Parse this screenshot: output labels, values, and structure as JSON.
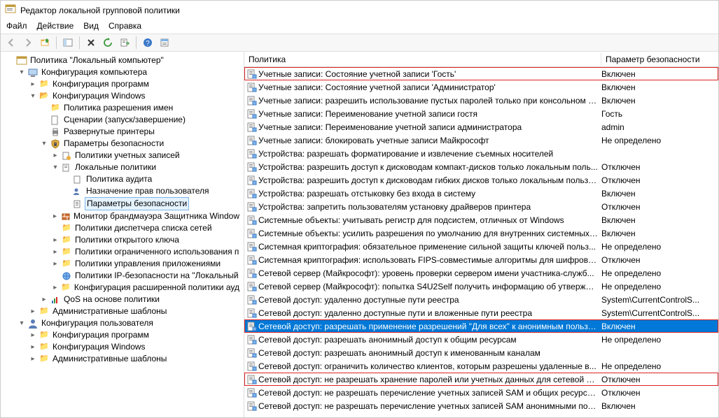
{
  "window": {
    "title": "Редактор локальной групповой политики"
  },
  "menu": {
    "file": "Файл",
    "action": "Действие",
    "view": "Вид",
    "help": "Справка"
  },
  "toolbar_icons": {
    "back": "back-icon",
    "forward": "forward-icon",
    "up": "up-icon",
    "show_hide": "show-hide-icon",
    "delete": "delete-icon",
    "refresh": "refresh-icon",
    "export": "export-icon",
    "help": "help-icon",
    "props": "properties-icon"
  },
  "tree": {
    "root": "Политика \"Локальный компьютер\"",
    "computer_cfg": "Конфигурация компьютера",
    "soft_cfg": "Конфигурация программ",
    "win_cfg": "Конфигурация Windows",
    "name_res_policy": "Политика разрешения имен",
    "scripts": "Сценарии (запуск/завершение)",
    "deployed_printers": "Развернутые принтеры",
    "security_settings": "Параметры безопасности",
    "account_policies": "Политики учетных записей",
    "local_policies": "Локальные политики",
    "audit_policy": "Политика аудита",
    "user_rights": "Назначение прав пользователя",
    "security_options": "Параметры безопасности",
    "firewall_monitor": "Монитор брандмауэра Защитника Window",
    "nlm_policies": "Политики диспетчера списка сетей",
    "pubkey_policies": "Политики открытого ключа",
    "software_restrict": "Политики ограниченного использования п",
    "app_control": "Политики управления приложениями",
    "ipsec": "Политики IP-безопасности на \"Локальный",
    "adv_audit": "Конфигурация расширенной политики ауд",
    "qos": "QoS на основе политики",
    "admin_templates_c": "Административные шаблоны",
    "user_cfg": "Конфигурация пользователя",
    "soft_cfg_u": "Конфигурация программ",
    "win_cfg_u": "Конфигурация Windows",
    "admin_templates_u": "Административные шаблоны"
  },
  "list": {
    "headers": {
      "policy": "Политика",
      "value": "Параметр безопасности"
    },
    "rows": [
      {
        "label": "Учетные записи: Состояние учетной записи 'Гость'",
        "value": "Включен",
        "hl": true
      },
      {
        "label": "Учетные записи: Состояние учетной записи 'Администратор'",
        "value": "Включен"
      },
      {
        "label": "Учетные записи: разрешить использование пустых паролей только при консольном в...",
        "value": "Включен"
      },
      {
        "label": "Учетные записи: Переименование учетной записи гостя",
        "value": "Гость"
      },
      {
        "label": "Учетные записи: Переименование учетной записи администратора",
        "value": "admin"
      },
      {
        "label": "Учетные записи: блокировать учетные записи Майкрософт",
        "value": "Не определено"
      },
      {
        "label": "Устройства: разрешать форматирование и извлечение съемных носителей",
        "value": ""
      },
      {
        "label": "Устройства: разрешить доступ к дисководам компакт-дисков только локальным поль...",
        "value": "Отключен"
      },
      {
        "label": "Устройства: разрешить доступ к дисководам гибких дисков только локальным пользо...",
        "value": "Отключен"
      },
      {
        "label": "Устройства: разрешать отстыковку без входа в систему",
        "value": "Включен"
      },
      {
        "label": "Устройства: запретить пользователям установку драйверов принтера",
        "value": "Отключен"
      },
      {
        "label": "Системные объекты: учитывать регистр для подсистем, отличных от Windows",
        "value": "Включен"
      },
      {
        "label": "Системные объекты: усилить разрешения по умолчанию для внутренних системных ...",
        "value": "Включен"
      },
      {
        "label": "Системная криптография: обязательное применение сильной защиты ключей польз...",
        "value": "Не определено"
      },
      {
        "label": "Системная криптография: использовать FIPS-совместимые алгоритмы для шифрова...",
        "value": "Отключен"
      },
      {
        "label": "Сетевой сервер (Майкрософт): уровень проверки сервером имени участника-служб...",
        "value": "Не определено"
      },
      {
        "label": "Сетевой сервер (Майкрософт): попытка S4U2Self получить информацию об утвержде...",
        "value": "Не определено"
      },
      {
        "label": "Сетевой доступ: удаленно доступные пути реестра",
        "value": "System\\CurrentControlS..."
      },
      {
        "label": "Сетевой доступ: удаленно доступные пути и вложенные пути реестра",
        "value": "System\\CurrentControlS..."
      },
      {
        "label": "Сетевой доступ: разрешать применение разрешений \"Для всех\" к анонимным пользо...",
        "value": "Включен",
        "selected": true,
        "hl": true
      },
      {
        "label": "Сетевой доступ: разрешать анонимный доступ к общим ресурсам",
        "value": "Не определено"
      },
      {
        "label": "Сетевой доступ: разрешать анонимный доступ к именованным каналам",
        "value": ""
      },
      {
        "label": "Сетевой доступ: ограничить количество клиентов, которым разрешены удаленные в...",
        "value": "Не определено"
      },
      {
        "label": "Сетевой доступ: не разрешать хранение паролей или учетных данных для сетевой про...",
        "value": "Отключен",
        "hl": true
      },
      {
        "label": "Сетевой доступ: не разрешать перечисление учетных записей SAM и общих ресурсов ...",
        "value": "Отключен"
      },
      {
        "label": "Сетевой доступ: не разрешать перечисление учетных записей SAM анонимными поль...",
        "value": "Включен"
      }
    ]
  }
}
